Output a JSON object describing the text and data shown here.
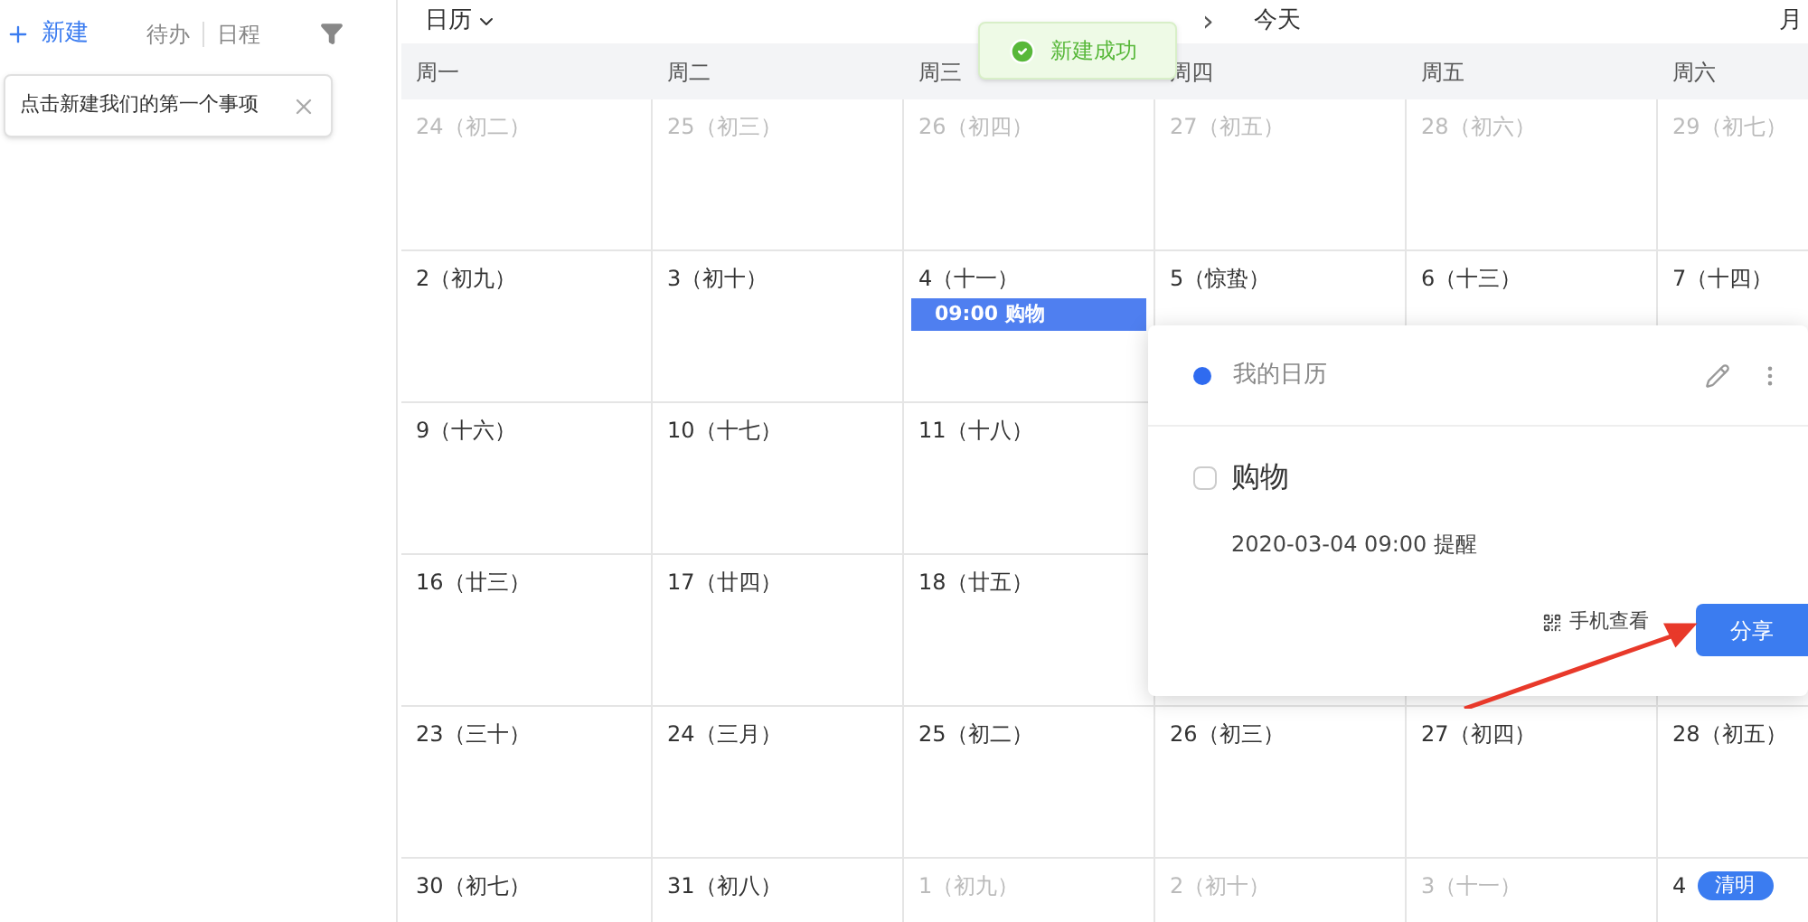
{
  "sidebar": {
    "new_button": "新建",
    "tabs": [
      {
        "label": "待办",
        "selected": false
      },
      {
        "label": "日程",
        "selected": false
      }
    ],
    "tooltip": "点击新建我们的第一个事项"
  },
  "header": {
    "view": "日历",
    "next": "›",
    "today": "今天",
    "mode": "月"
  },
  "toast": "新建成功",
  "weekdays": [
    "周一",
    "周二",
    "周三",
    "周四",
    "周五",
    "周六"
  ],
  "weeks": [
    [
      {
        "label": "24（初二）",
        "muted": true
      },
      {
        "label": "25（初三）",
        "muted": true
      },
      {
        "label": "26（初四）",
        "muted": true
      },
      {
        "label": "27（初五）",
        "muted": true
      },
      {
        "label": "28（初六）",
        "muted": true
      },
      {
        "label": "29（初七）",
        "muted": true
      }
    ],
    [
      {
        "label": "2（初九）",
        "muted": false
      },
      {
        "label": "3（初十）",
        "muted": false
      },
      {
        "label": "4（十一）",
        "muted": false,
        "events": [
          "09:00 购物"
        ]
      },
      {
        "label": "5（惊蛰）",
        "muted": false
      },
      {
        "label": "6（十三）",
        "muted": false
      },
      {
        "label": "7（十四）",
        "muted": false
      }
    ],
    [
      {
        "label": "9（十六）",
        "muted": false
      },
      {
        "label": "10（十七）",
        "muted": false
      },
      {
        "label": "11（十八）",
        "muted": false
      }
    ],
    [
      {
        "label": "16（廿三）",
        "muted": false
      },
      {
        "label": "17（廿四）",
        "muted": false
      },
      {
        "label": "18（廿五）",
        "muted": false
      }
    ],
    [
      {
        "label": "23（三十）",
        "muted": false
      },
      {
        "label": "24（三月）",
        "muted": false
      },
      {
        "label": "25（初二）",
        "muted": false
      },
      {
        "label": "26（初三）",
        "muted": false
      },
      {
        "label": "27（初四）",
        "muted": false
      },
      {
        "label": "28（初五）",
        "muted": false
      }
    ],
    [
      {
        "label": "30（初七）",
        "muted": false
      },
      {
        "label": "31（初八）",
        "muted": false
      },
      {
        "label": "1（初九）",
        "muted": true
      },
      {
        "label": "2（初十）",
        "muted": true
      },
      {
        "label": "3（十一）",
        "muted": true
      },
      {
        "label": "4",
        "muted": false,
        "badge": "清明"
      }
    ]
  ],
  "popup": {
    "calendar": "我的日历",
    "task": "购物",
    "done": false,
    "reminder": "2020-03-04 09:00 提醒",
    "mobile": "手机查看",
    "share": "分享"
  }
}
